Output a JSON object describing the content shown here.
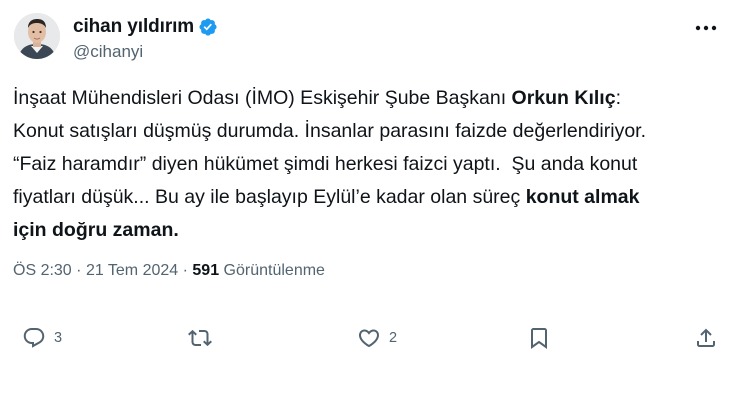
{
  "author": {
    "display_name": "cihan yıldırım",
    "handle": "@cihanyi"
  },
  "tweet": {
    "segments": [
      {
        "text": "İnşaat Mühendisleri Odası (İMO) Eskişehir Şube Başkanı ",
        "bold": false
      },
      {
        "text": "Orkun Kılıç",
        "bold": true
      },
      {
        "text": ":\nKonut satışları düşmüş durumda. İnsanlar parasını faizde değerlendiriyor.\n“Faiz haramdır” diyen hükümet şimdi herkesi faizci yaptı.  Şu anda konut\nfiyatları düşük... Bu ay ile başlayıp Eylül’e kadar olan süreç ",
        "bold": false
      },
      {
        "text": "konut almak\niçin doğru zaman.",
        "bold": true
      }
    ]
  },
  "meta": {
    "time": "ÖS 2:30",
    "separator": "·",
    "date": "21 Tem 2024",
    "views_count": "591",
    "views_label": "Görüntülenme"
  },
  "actions": {
    "reply_count": "3",
    "retweet_count": "",
    "like_count": "2",
    "bookmark_count": "",
    "share_count": ""
  },
  "icons": {
    "verified": "verified-badge-icon",
    "more": "more-horizontal-icon",
    "reply": "reply-icon",
    "retweet": "retweet-icon",
    "like": "heart-icon",
    "bookmark": "bookmark-icon",
    "share": "share-icon"
  },
  "colors": {
    "text": "#0f1419",
    "secondary": "#536471",
    "verified": "#1d9bf0",
    "background": "#ffffff"
  }
}
